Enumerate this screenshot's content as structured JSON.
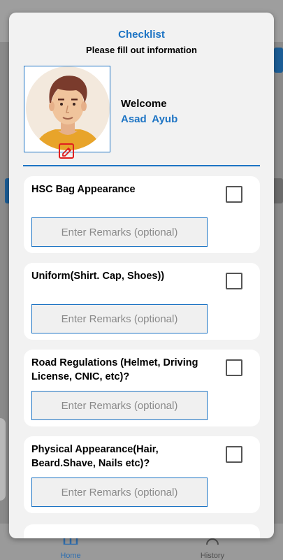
{
  "background": {
    "nav": {
      "home_label": "Home",
      "history_label": "History"
    }
  },
  "dialog": {
    "title": "Checklist",
    "subtitle": "Please fill out information",
    "welcome": "Welcome",
    "user_name": "Asad  Ayub",
    "items": [
      {
        "label": "HSC Bag Appearance",
        "checked": false,
        "remarks_value": "",
        "remarks_placeholder": "Enter Remarks (optional)"
      },
      {
        "label": "Uniform(Shirt. Cap, Shoes))",
        "checked": false,
        "remarks_value": "",
        "remarks_placeholder": "Enter Remarks (optional)"
      },
      {
        "label": "Road Regulations (Helmet, Driving License, CNIC, etc)?",
        "checked": false,
        "remarks_value": "",
        "remarks_placeholder": "Enter Remarks (optional)"
      },
      {
        "label": "Physical Appearance(Hair, Beard.Shave, Nails etc)?",
        "checked": false,
        "remarks_value": "",
        "remarks_placeholder": "Enter Remarks (optional)"
      }
    ]
  },
  "colors": {
    "accent": "#1d74c4",
    "edit_icon": "#e01f1f",
    "dialog_bg": "#f2f2f2",
    "card_bg": "#ffffff"
  },
  "icons": {
    "avatar": "avatar-illustration-icon",
    "edit": "pencil-edit-icon",
    "home": "home-icon",
    "history": "history-icon"
  }
}
